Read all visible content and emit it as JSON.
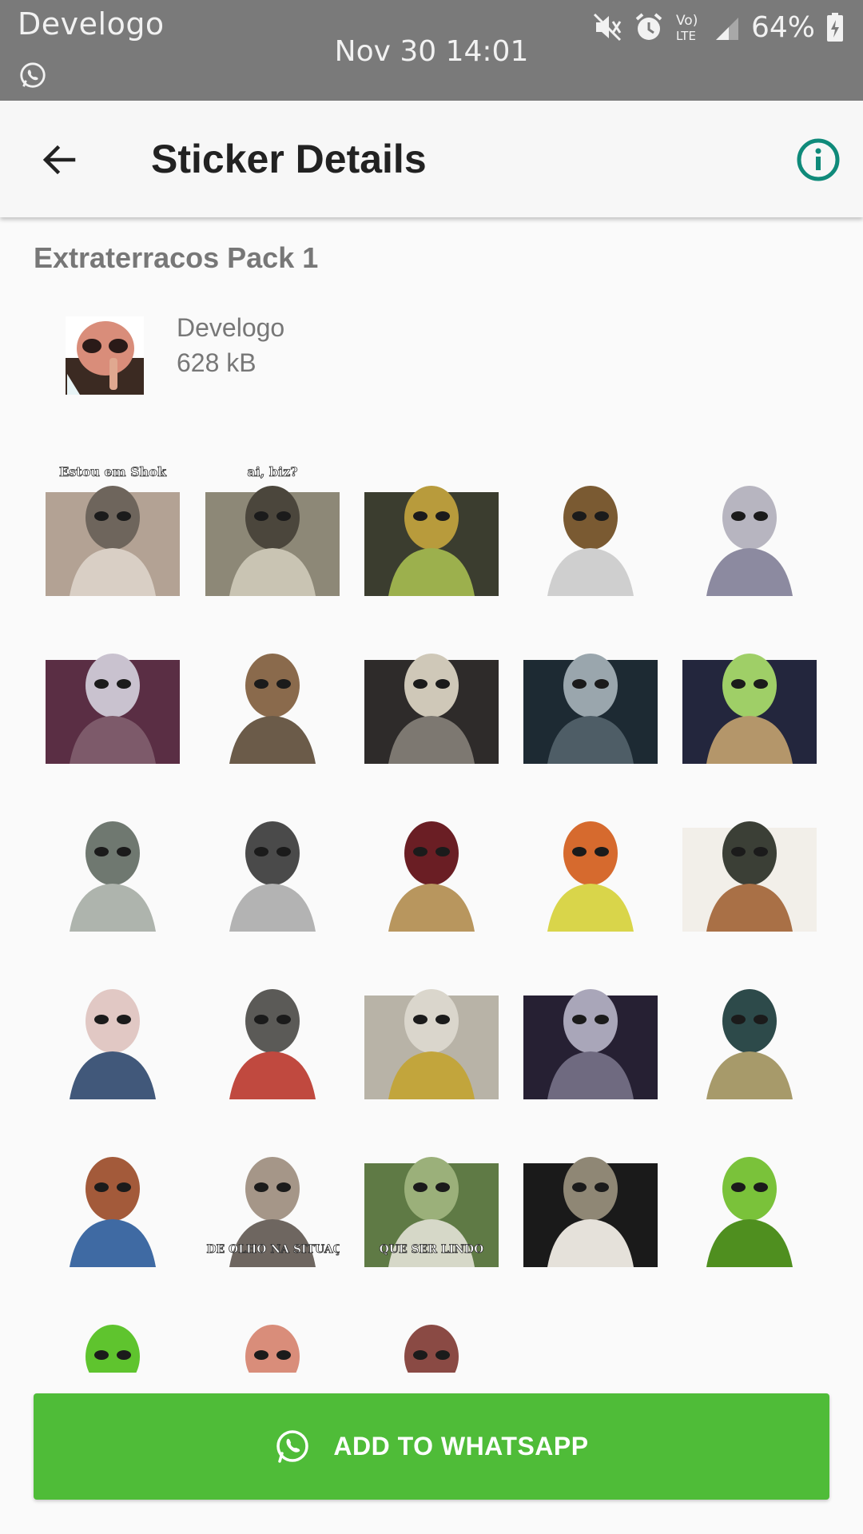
{
  "status_bar": {
    "app_name": "Develogo",
    "datetime": "Nov 30 14:01",
    "network_label_top": "Vo)",
    "network_label_bottom": "LTE",
    "battery": "64%"
  },
  "app_bar": {
    "title": "Sticker Details"
  },
  "pack": {
    "name": "Extraterracos Pack 1",
    "publisher": "Develogo",
    "size": "628 kB"
  },
  "stickers": [
    {
      "caption": "Estou em Shok",
      "colors": [
        "#b3a294",
        "#6e655c",
        "#d9cfc5"
      ]
    },
    {
      "caption": "ai, biz?",
      "colors": [
        "#8d8877",
        "#4b463c",
        "#c9c4b3"
      ]
    },
    {
      "caption": "",
      "colors": [
        "#3b3d2f",
        "#b89b3c",
        "#9cb04d"
      ]
    },
    {
      "caption": "",
      "colors": [
        "#ffffff",
        "#7a5a32",
        "#cfcfcf"
      ]
    },
    {
      "caption": "",
      "colors": [
        "#ffffff",
        "#b7b5c0",
        "#8c8aa0"
      ]
    },
    {
      "caption": "",
      "colors": [
        "#5a2e44",
        "#c9c2cf",
        "#7d5a6a"
      ]
    },
    {
      "caption": "",
      "colors": [
        "#ffffff",
        "#8a6a4c",
        "#6b5b49"
      ]
    },
    {
      "caption": "",
      "colors": [
        "#2e2b2a",
        "#cfc8b8",
        "#7d7871"
      ]
    },
    {
      "caption": "",
      "colors": [
        "#1d2a33",
        "#9aa6ad",
        "#4e5d66"
      ]
    },
    {
      "caption": "",
      "colors": [
        "#23263d",
        "#9fcf67",
        "#b4966a"
      ]
    },
    {
      "caption": "",
      "colors": [
        "#ffffff",
        "#6f7870",
        "#aeb4ad"
      ]
    },
    {
      "caption": "",
      "colors": [
        "#ffffff",
        "#4a4a4a",
        "#b3b3b3"
      ]
    },
    {
      "caption": "",
      "colors": [
        "#ffffff",
        "#6a1e24",
        "#b8965e"
      ]
    },
    {
      "caption": "",
      "colors": [
        "#ffffff",
        "#d66a2e",
        "#d9d54a"
      ]
    },
    {
      "caption": "",
      "colors": [
        "#f2efe9",
        "#3b3f36",
        "#a97046"
      ]
    },
    {
      "caption": "",
      "colors": [
        "#ffffff",
        "#e1c8c4",
        "#41587a"
      ]
    },
    {
      "caption": "",
      "colors": [
        "#ffffff",
        "#5b5a57",
        "#c0493f"
      ]
    },
    {
      "caption": "",
      "colors": [
        "#b8b3a7",
        "#dad6cc",
        "#c2a53c"
      ]
    },
    {
      "caption": "",
      "colors": [
        "#262033",
        "#a9a6b9",
        "#6f6a80"
      ]
    },
    {
      "caption": "",
      "colors": [
        "#ffffff",
        "#2d4a4a",
        "#a79a6a"
      ]
    },
    {
      "caption": "",
      "colors": [
        "#ffffff",
        "#a35a3a",
        "#3f6aa3"
      ]
    },
    {
      "caption": "SÓ DE OLHO NA SITUAÇÃO",
      "colors": [
        "#ffffff",
        "#a59688",
        "#6e6660"
      ]
    },
    {
      "caption": "QUE SER LINDO",
      "colors": [
        "#5f7a45",
        "#9bb07a",
        "#d6d8c8"
      ]
    },
    {
      "caption": "",
      "colors": [
        "#1a1a1a",
        "#8f8775",
        "#e5e1da"
      ]
    },
    {
      "caption": "",
      "colors": [
        "#ffffff",
        "#7ac23a",
        "#4f8f1f"
      ]
    },
    {
      "caption": "",
      "colors": [
        "#ffffff",
        "#5fc42e",
        "#2f6e1a"
      ]
    },
    {
      "caption": "",
      "colors": [
        "#ffffff",
        "#d98d7a",
        "#3a2622"
      ]
    },
    {
      "caption": "",
      "colors": [
        "#ffffff",
        "#8a4a44",
        "#c27a6a"
      ]
    }
  ],
  "button": {
    "label": "ADD TO WHATSAPP"
  }
}
